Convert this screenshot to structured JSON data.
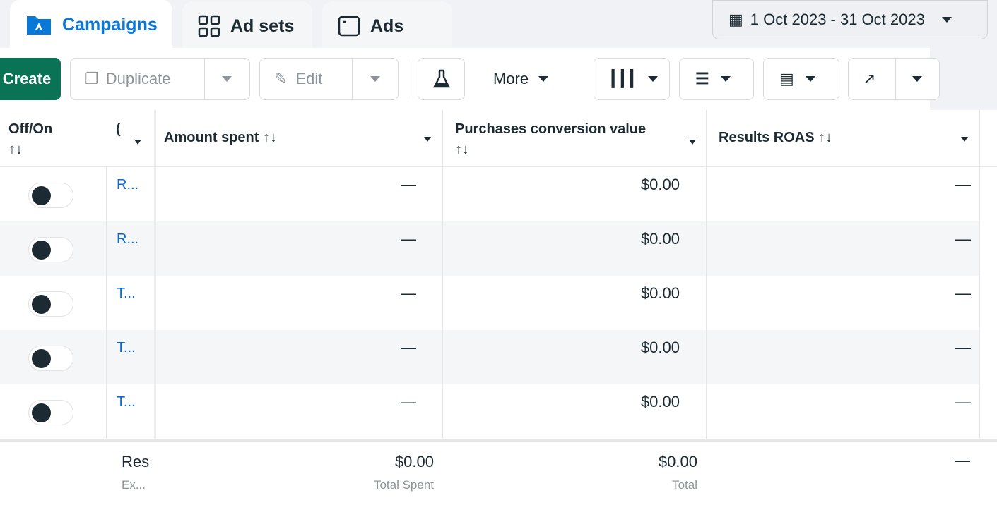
{
  "tabs": [
    {
      "label": "Campaigns",
      "icon": "campaign-folder-icon",
      "active": true
    },
    {
      "label": "Ad sets",
      "icon": "ad-sets-grid-icon"
    },
    {
      "label": "Ads",
      "icon": "ads-window-icon"
    }
  ],
  "date_range": "1 Oct 2023 - 31 Oct 2023",
  "toolbar": {
    "create": "Create",
    "duplicate": "Duplicate",
    "edit": "Edit",
    "more": "More"
  },
  "columns": {
    "off_on": "Off/On",
    "name": "(",
    "amount": "Amount spent",
    "purchases": "Purchases conversion value",
    "roas": "Results ROAS",
    "sort": "↑↓"
  },
  "rows": [
    {
      "name": "R...",
      "amount": "—",
      "purchases": "$0.00",
      "roas": "—"
    },
    {
      "name": "R...",
      "amount": "—",
      "purchases": "$0.00",
      "roas": "—"
    },
    {
      "name": "T...",
      "amount": "—",
      "purchases": "$0.00",
      "roas": "—"
    },
    {
      "name": "T...",
      "amount": "—",
      "purchases": "$0.00",
      "roas": "—"
    },
    {
      "name": "T...",
      "amount": "—",
      "purchases": "$0.00",
      "roas": "—"
    }
  ],
  "footer": {
    "name": "Res",
    "name_sub": "Ex...",
    "amount": "$0.00",
    "amount_sub": "Total Spent",
    "purchases": "$0.00",
    "purchases_sub": "Total",
    "roas": "—"
  },
  "colors": {
    "accent": "#0a78d6",
    "create": "#0b7355"
  }
}
